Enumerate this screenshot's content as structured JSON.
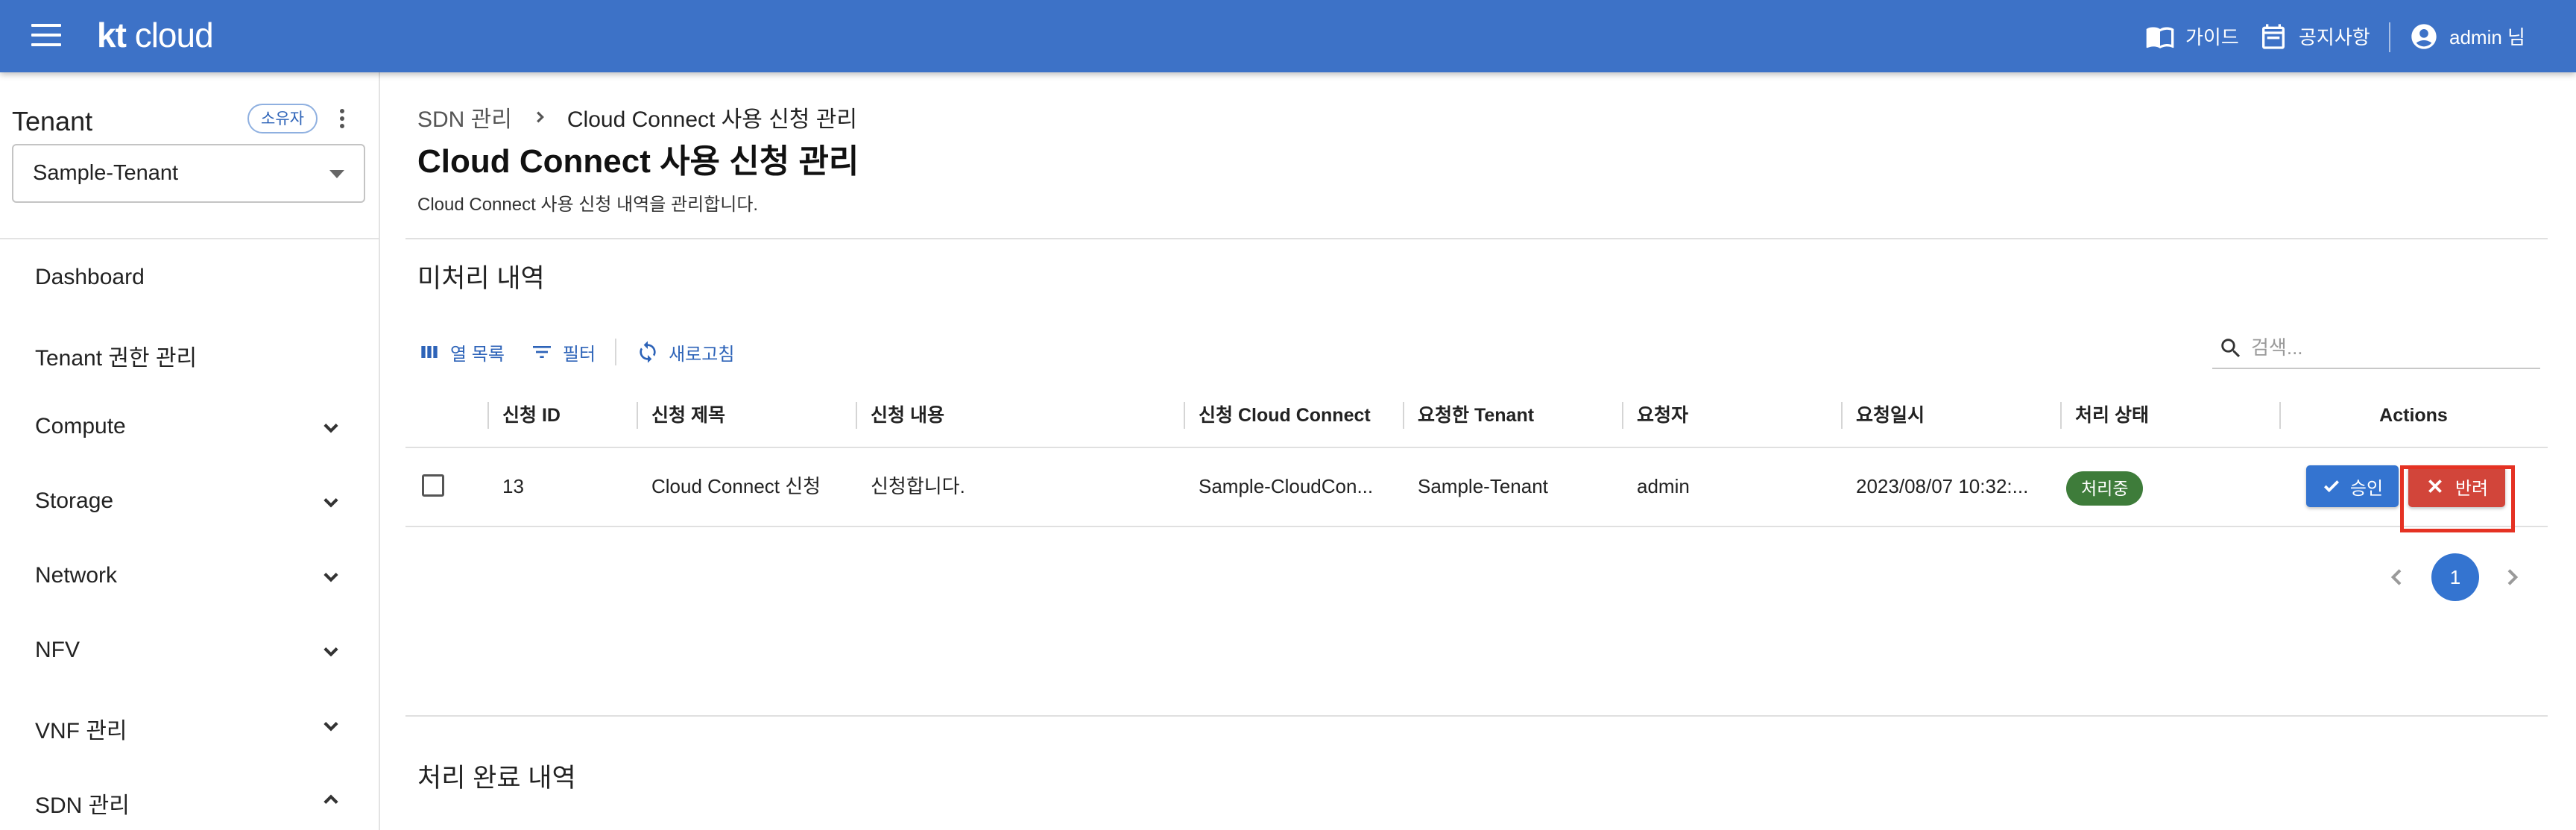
{
  "header": {
    "logo_kt": "kt",
    "logo_cloud": "cloud",
    "guide_label": "가이드",
    "notice_label": "공지사항",
    "user_label": "admin 님"
  },
  "sidebar": {
    "tenant_heading": "Tenant",
    "owner_badge": "소유자",
    "tenant_selected": "Sample-Tenant",
    "items": [
      {
        "label": "Dashboard"
      },
      {
        "label": "Tenant 권한 관리"
      },
      {
        "label": "Compute"
      },
      {
        "label": "Storage"
      },
      {
        "label": "Network"
      },
      {
        "label": "NFV"
      },
      {
        "label": "VNF 관리"
      },
      {
        "label": "SDN 관리"
      }
    ]
  },
  "breadcrumb": {
    "parent": "SDN 관리",
    "current": "Cloud Connect 사용 신청 관리"
  },
  "page": {
    "title": "Cloud Connect 사용 신청 관리",
    "description": "Cloud Connect 사용 신청 내역을 관리합니다."
  },
  "pending": {
    "title": "미처리 내역",
    "toolbar": {
      "columns": "열 목록",
      "filter": "필터",
      "refresh": "새로고침"
    },
    "search_placeholder": "검색...",
    "columns": [
      "신청 ID",
      "신청 제목",
      "신청 내용",
      "신청 Cloud Connect",
      "요청한 Tenant",
      "요청자",
      "요청일시",
      "처리 상태",
      "Actions"
    ],
    "rows": [
      {
        "id": "13",
        "title": "Cloud Connect 신청",
        "content": "신청합니다.",
        "cloud_connect": "Sample-CloudCon...",
        "tenant": "Sample-Tenant",
        "requester": "admin",
        "requested_at": "2023/08/07 10:32:...",
        "status": "처리중",
        "approve": "승인",
        "reject": "반려"
      }
    ],
    "page": "1"
  },
  "completed": {
    "title": "처리 완료 내역"
  },
  "colors": {
    "header": "#3d72c7",
    "primary": "#3474d0",
    "reject": "#d2453a",
    "status_chip": "#3e7c3a",
    "highlight": "#e53223"
  }
}
